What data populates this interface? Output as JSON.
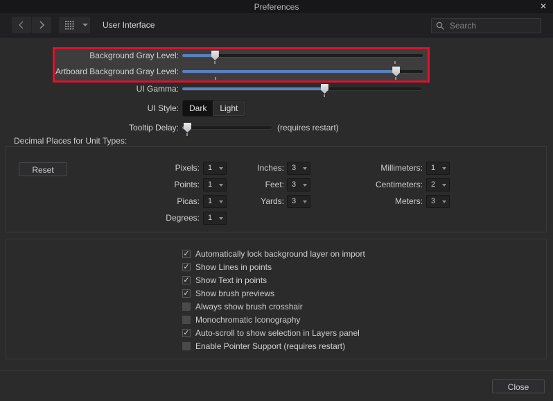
{
  "window": {
    "title": "Preferences",
    "close_icon": "✕"
  },
  "toolbar": {
    "back_icon": "chevron-left",
    "forward_icon": "chevron-right",
    "grid_icon": "sections-grid",
    "grid_dropdown_icon": "triangle-down",
    "section_label": "User Interface",
    "search": {
      "icon": "magnifier",
      "placeholder": "Search"
    }
  },
  "colors": {
    "accent_blue": "#5a81bd",
    "highlight_red": "#e0112b"
  },
  "settings": {
    "sliders": [
      {
        "label": "Background Gray Level:",
        "value_pct": 13.5,
        "ticks": [
          13.5,
          88.5
        ],
        "highlighted": true
      },
      {
        "label": "Artboard Background Gray Level:",
        "value_pct": 88.8,
        "ticks": [
          13.8,
          88.8
        ],
        "highlighted": true
      },
      {
        "label": "UI Gamma:",
        "value_pct": 59.4,
        "ticks": [
          59.4
        ],
        "highlighted": false
      },
      {
        "label": "Tooltip Delay:",
        "value_pct": 5.4,
        "ticks": [
          5.4
        ],
        "highlighted": false,
        "note": "(requires restart)"
      }
    ],
    "ui_style": {
      "label": "UI Style:",
      "options": [
        {
          "label": "Dark",
          "selected": true
        },
        {
          "label": "Light",
          "selected": false
        }
      ]
    }
  },
  "decimal_places": {
    "heading": "Decimal Places for Unit Types:",
    "reset_label": "Reset",
    "columns": [
      [
        {
          "label": "Pixels:",
          "value": "1"
        },
        {
          "label": "Points:",
          "value": "1"
        },
        {
          "label": "Picas:",
          "value": "1"
        },
        {
          "label": "Degrees:",
          "value": "1"
        }
      ],
      [
        {
          "label": "Inches:",
          "value": "3"
        },
        {
          "label": "Feet:",
          "value": "3"
        },
        {
          "label": "Yards:",
          "value": "3"
        }
      ],
      [
        {
          "label": "Millimeters:",
          "value": "1"
        },
        {
          "label": "Centimeters:",
          "value": "2"
        },
        {
          "label": "Meters:",
          "value": "3"
        }
      ]
    ]
  },
  "options": {
    "checkmark_icon": "✓",
    "checkboxes": [
      {
        "label": "Automatically lock background layer on import",
        "checked": true
      },
      {
        "label": "Show Lines in points",
        "checked": true
      },
      {
        "label": "Show Text in points",
        "checked": true
      },
      {
        "label": "Show brush previews",
        "checked": true
      },
      {
        "label": "Always show brush crosshair",
        "checked": false
      },
      {
        "label": "Monochromatic Iconography",
        "checked": false
      },
      {
        "label": "Auto-scroll to show selection in Layers panel",
        "checked": true
      },
      {
        "label": "Enable Pointer Support (requires restart)",
        "checked": false
      }
    ]
  },
  "footer": {
    "close_label": "Close"
  }
}
